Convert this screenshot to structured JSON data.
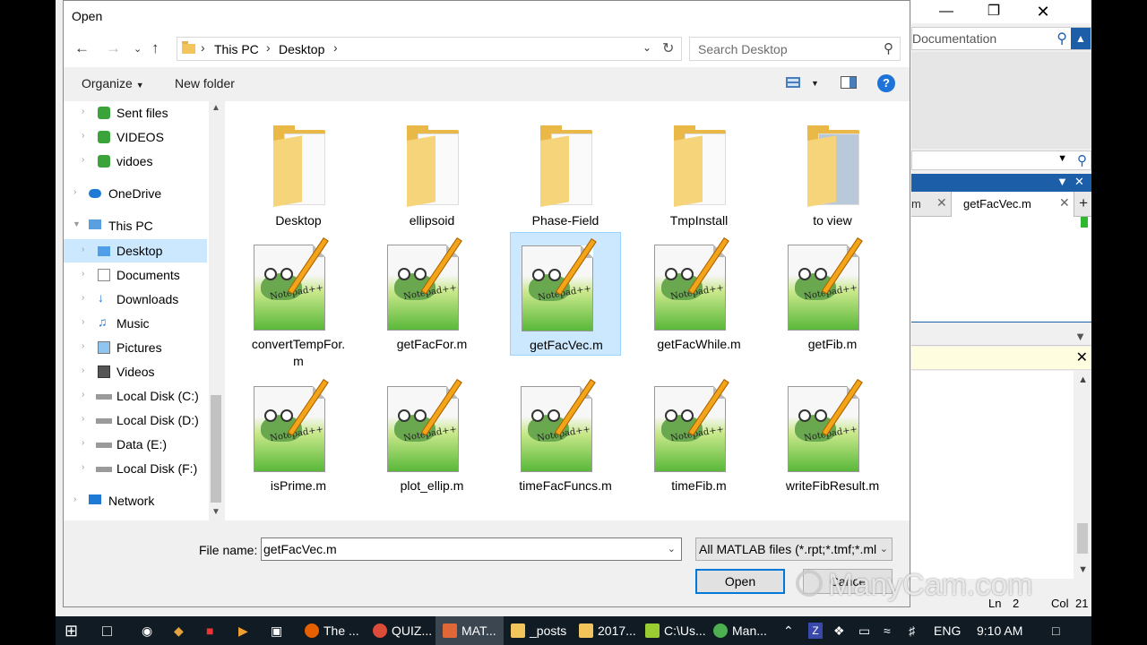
{
  "background_app": {
    "search_placeholder": "Documentation",
    "tabs": [
      "m",
      "getFacVec.m"
    ],
    "status": {
      "ln_label": "Ln",
      "ln": "2",
      "col_label": "Col",
      "col": "21"
    }
  },
  "dialog": {
    "title": "Open",
    "breadcrumb": [
      "This PC",
      "Desktop"
    ],
    "search_placeholder": "Search Desktop",
    "toolbar": {
      "organize": "Organize",
      "new_folder": "New folder",
      "help": "?"
    },
    "nav_items": [
      {
        "label": "Sent files",
        "icon": "folder-green-icon"
      },
      {
        "label": "VIDEOS",
        "icon": "folder-green-icon"
      },
      {
        "label": "vidoes",
        "icon": "folder-green-icon"
      },
      {
        "label": "OneDrive",
        "icon": "cloud-icon"
      },
      {
        "label": "This PC",
        "icon": "computer-icon"
      },
      {
        "label": "Desktop",
        "icon": "folder-blue-icon",
        "selected": true
      },
      {
        "label": "Documents",
        "icon": "documents-icon"
      },
      {
        "label": "Downloads",
        "icon": "downloads-icon"
      },
      {
        "label": "Music",
        "icon": "music-icon"
      },
      {
        "label": "Pictures",
        "icon": "pictures-icon"
      },
      {
        "label": "Videos",
        "icon": "videos-icon"
      },
      {
        "label": "Local Disk (C:)",
        "icon": "drive-icon"
      },
      {
        "label": "Local Disk (D:)",
        "icon": "drive-icon"
      },
      {
        "label": "Data (E:)",
        "icon": "drive-icon"
      },
      {
        "label": "Local Disk (F:)",
        "icon": "drive-icon"
      },
      {
        "label": "Network",
        "icon": "network-icon"
      }
    ],
    "files": [
      {
        "name": "Desktop",
        "type": "folder"
      },
      {
        "name": "ellipsoid",
        "type": "folder"
      },
      {
        "name": "Phase-Field",
        "type": "folder"
      },
      {
        "name": "TmpInstall",
        "type": "folder"
      },
      {
        "name": "to view",
        "type": "folder"
      },
      {
        "name": "convertTempFor.\nm",
        "type": "m-file"
      },
      {
        "name": "getFacFor.m",
        "type": "m-file"
      },
      {
        "name": "getFacVec.m",
        "type": "m-file",
        "selected": true
      },
      {
        "name": "getFacWhile.m",
        "type": "m-file"
      },
      {
        "name": "getFib.m",
        "type": "m-file"
      },
      {
        "name": "isPrime.m",
        "type": "m-file"
      },
      {
        "name": "plot_ellip.m",
        "type": "m-file"
      },
      {
        "name": "timeFacFuncs.m",
        "type": "m-file"
      },
      {
        "name": "timeFib.m",
        "type": "m-file"
      },
      {
        "name": "writeFibResult.m",
        "type": "m-file"
      }
    ],
    "file_name_label": "File name:",
    "file_name_value": "getFacVec.m",
    "file_type": "All MATLAB files (*.rpt;*.tmf;*.ml",
    "open_button": "Open",
    "cancel_button": "Cance"
  },
  "watermark": "ManyCam.com",
  "taskbar": {
    "items": [
      {
        "label": "The ...",
        "icon": "firefox-icon",
        "color": "#e66000"
      },
      {
        "label": "QUIZ...",
        "icon": "chrome-icon",
        "color": "#dd4b39"
      },
      {
        "label": "MAT...",
        "icon": "matlab-icon",
        "color": "#e16737",
        "active": true
      },
      {
        "label": "_posts",
        "icon": "folder-icon",
        "color": "#f2c55c"
      },
      {
        "label": "2017...",
        "icon": "folder-icon",
        "color": "#f2c55c"
      },
      {
        "label": "C:\\Us...",
        "icon": "notepad-icon",
        "color": "#9acd32"
      },
      {
        "label": "Man...",
        "icon": "chrome-icon",
        "color": "#4caf50"
      }
    ],
    "tray": {
      "lang": "ENG",
      "time": "9:10 AM"
    }
  }
}
